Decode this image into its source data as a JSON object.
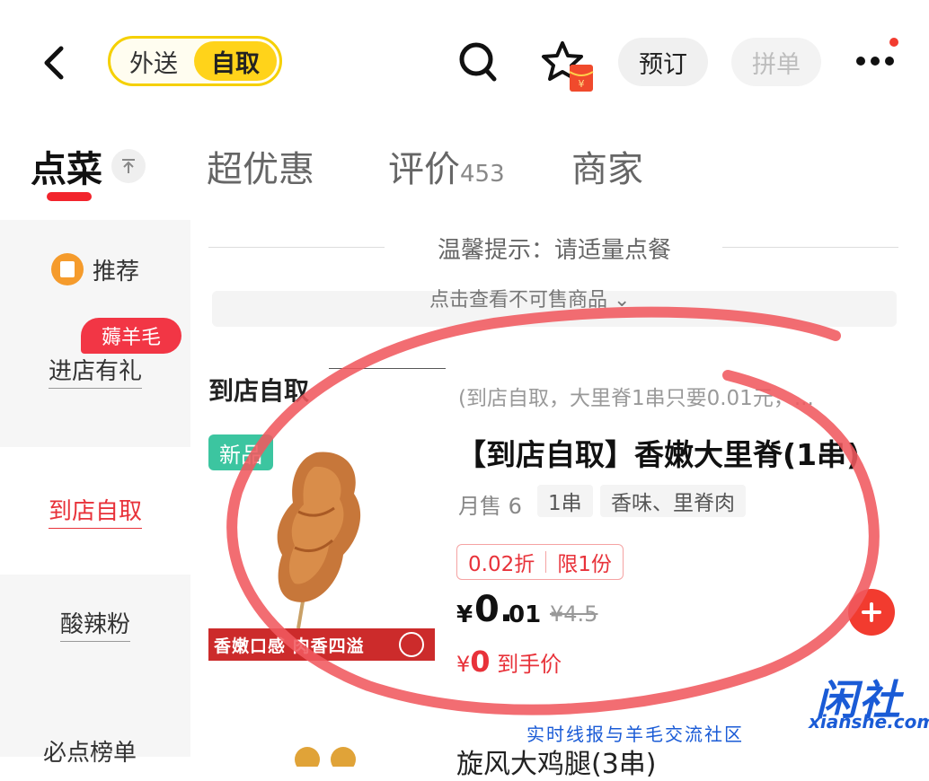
{
  "topbar": {
    "mode_delivery": "外送",
    "mode_pickup": "自取",
    "reserve_label": "预订",
    "group_label": "拼单",
    "icons": [
      "back-icon",
      "search-icon",
      "favorite-star-icon",
      "red-packet-icon",
      "more-icon"
    ],
    "accent_color": "#ffd31a"
  },
  "tabs": [
    {
      "label": "点菜"
    },
    {
      "label": "超优惠"
    },
    {
      "label": "评价",
      "count": "453"
    },
    {
      "label": "商家"
    }
  ],
  "sidebar": {
    "items": [
      {
        "label": "推荐"
      },
      {
        "label": "进店有礼",
        "badge": "薅羊毛"
      },
      {
        "label": "到店自取"
      },
      {
        "label": "酸辣粉"
      },
      {
        "label": "必点榜单"
      }
    ]
  },
  "notice": {
    "text": "温馨提示：请适量点餐",
    "collapsed": "点击查看不可售商品"
  },
  "section": {
    "title": "到店自取",
    "description": "(到店自取，大里脊1串只要0.01元，..."
  },
  "product": {
    "badge": "新品",
    "title": "【到店自取】香嫩大里脊(1串)",
    "monthly_sales": "月售 6",
    "tags": [
      "1串",
      "香味、里脊肉"
    ],
    "discount": "0.02折",
    "limit": "限1份",
    "price_symbol": "¥",
    "price_int": "0.",
    "price_dec": "01",
    "original_price": "¥4.5",
    "hand_price_symbol": "¥",
    "hand_price_value": "0",
    "hand_price_label": "到手价",
    "image_caption": "香嫩口感 肉香四溢",
    "accent_color": "#e8323a"
  },
  "next_product": {
    "title": "旋风大鸡腿(3串)"
  },
  "watermark": {
    "logo": "闲社",
    "domain": "xianshe.com",
    "tagline": "实时线报与羊毛交流社区"
  }
}
